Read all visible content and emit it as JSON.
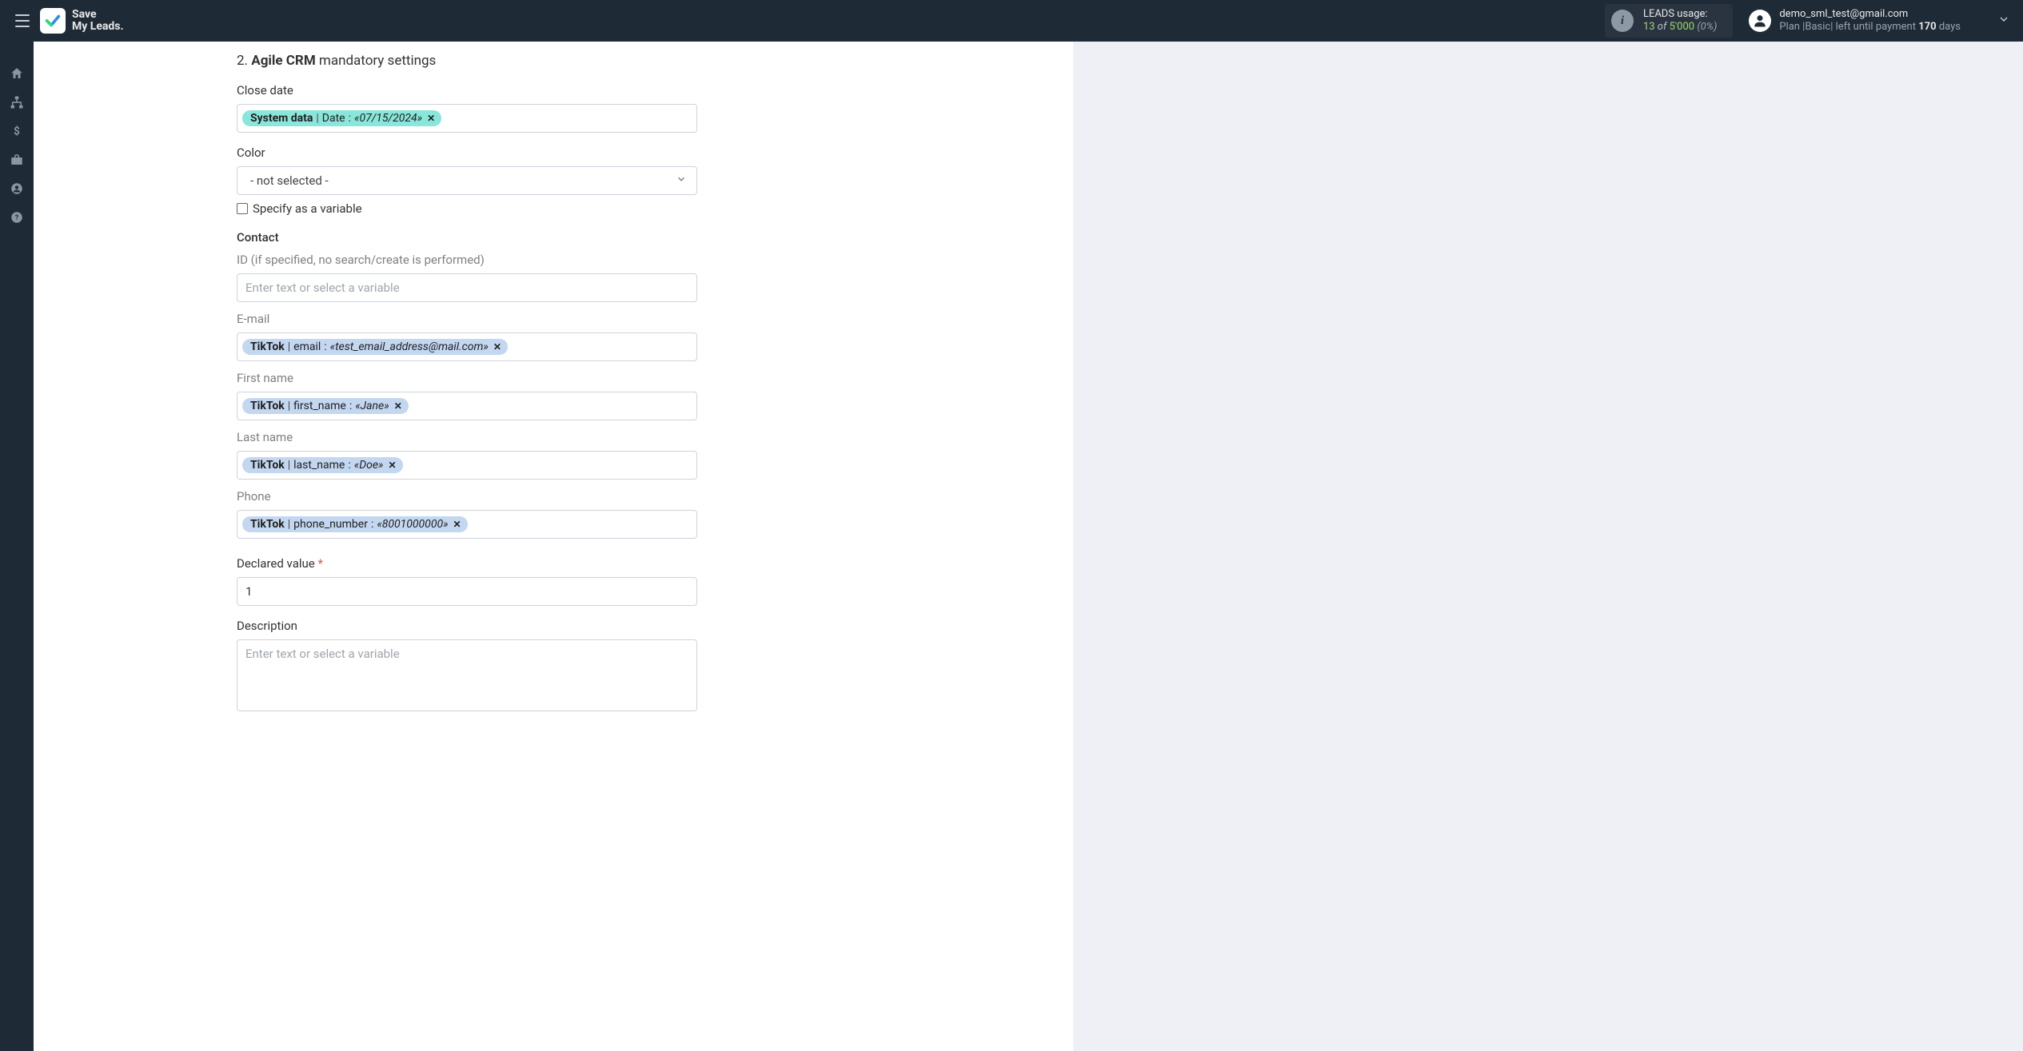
{
  "brand": {
    "line1": "Save",
    "line2": "My Leads."
  },
  "usage": {
    "label": "LEADS usage:",
    "used": "13",
    "of": "of",
    "total": "5'000",
    "pct": "(0%)"
  },
  "account": {
    "email": "demo_sml_test@gmail.com",
    "plan_prefix": "Plan |",
    "plan_name": "Basic",
    "plan_mid": "| left until payment ",
    "days_num": "170",
    "days_word": " days"
  },
  "section": {
    "num": "2. ",
    "strong": "Agile CRM",
    "rest": " mandatory settings"
  },
  "fields": {
    "close_date": {
      "label": "Close date",
      "token_source": "System data",
      "token_field": "Date",
      "token_value": "«07/15/2024»"
    },
    "color": {
      "label": "Color",
      "selected": "- not selected -",
      "checkbox_label": "Specify as a variable"
    },
    "contact": {
      "label": "Contact"
    },
    "id": {
      "label": "ID (if specified, no search/create is performed)",
      "placeholder": "Enter text or select a variable"
    },
    "email": {
      "label": "E-mail",
      "token_source": "TikTok",
      "token_field": "email",
      "token_value": "«test_email_address@mail.com»"
    },
    "first_name": {
      "label": "First name",
      "token_source": "TikTok",
      "token_field": "first_name",
      "token_value": "«Jane»"
    },
    "last_name": {
      "label": "Last name",
      "token_source": "TikTok",
      "token_field": "last_name",
      "token_value": "«Doe»"
    },
    "phone": {
      "label": "Phone",
      "token_source": "TikTok",
      "token_field": "phone_number",
      "token_value": "«8001000000»"
    },
    "declared_value": {
      "label": "Declared value",
      "value": "1"
    },
    "description": {
      "label": "Description",
      "placeholder": "Enter text or select a variable"
    }
  }
}
